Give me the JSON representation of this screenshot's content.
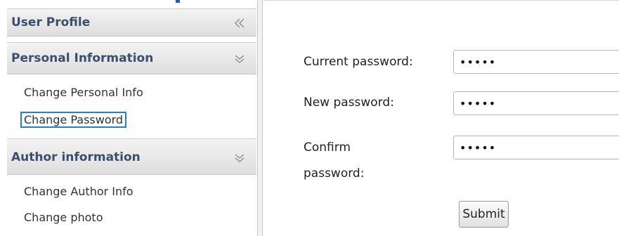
{
  "sidebar": {
    "sections": [
      {
        "title": "User Profile",
        "toggle_icon": "double-chevron-left-icon",
        "items": []
      },
      {
        "title": "Personal Information",
        "toggle_icon": "double-chevron-down-icon",
        "items": [
          {
            "label": "Change Personal Info"
          },
          {
            "label": "Change Password"
          }
        ]
      },
      {
        "title": "Author information",
        "toggle_icon": "double-chevron-down-icon",
        "items": [
          {
            "label": "Change Author Info"
          },
          {
            "label": "Change photo"
          }
        ]
      }
    ],
    "focused_item": "Change Password"
  },
  "form": {
    "current_password": {
      "label": "Current password:",
      "value": "•••••"
    },
    "new_password": {
      "label": "New password:",
      "value": "•••••"
    },
    "confirm_password": {
      "label_line1": "Confirm",
      "label_line2": "password:",
      "value": "•••••"
    },
    "submit_label": "Submit"
  },
  "colors": {
    "header_text": "#3a4f6e",
    "focus_outline": "#1f7fd6",
    "chevron": "#9a9a9a"
  }
}
